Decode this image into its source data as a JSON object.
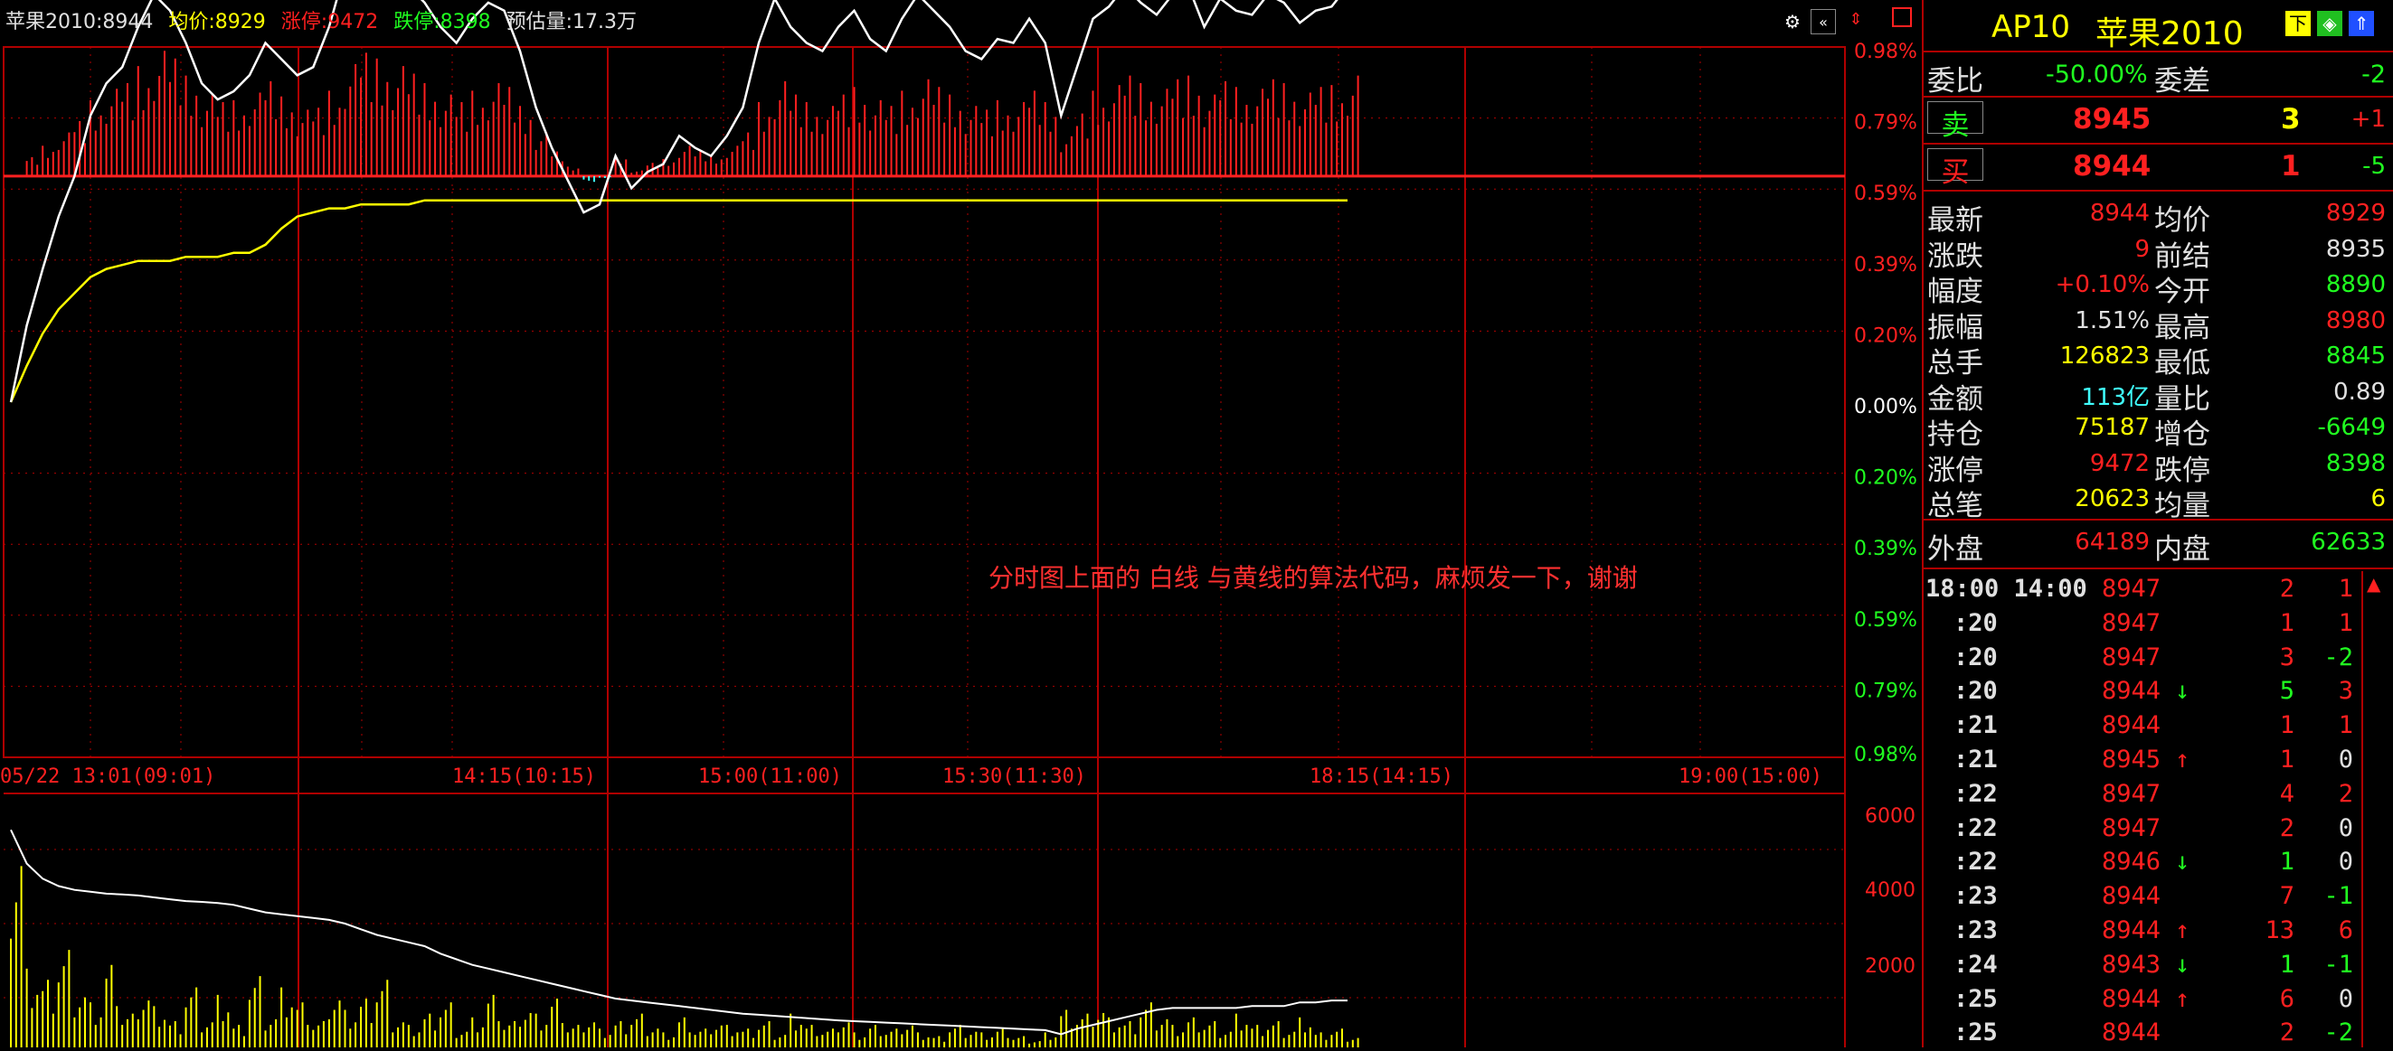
{
  "header": {
    "symbol_price": "苹果2010:8944",
    "avg": "均价:8929",
    "limit_up": "涨停:9472",
    "limit_down": "跌停:8398",
    "est_volume": "预估量:17.3万"
  },
  "annotation": "分时图上面的 白线 与黄线的算法代码，麻烦发一下，谢谢",
  "price_axis_labels": [
    "0.98%",
    "0.79%",
    "0.59%",
    "0.39%",
    "0.20%",
    "0.00%",
    "0.20%",
    "0.39%",
    "0.59%",
    "0.79%",
    "0.98%"
  ],
  "volume_axis_labels": [
    "6000",
    "4000",
    "2000"
  ],
  "time_axis_labels": [
    "05/22 13:01(09:01)",
    "14:15(10:15)",
    "15:00(11:00)",
    "15:30(11:30)",
    "18:15(14:15)",
    "19:00(15:00)"
  ],
  "chart_data": {
    "type": "line",
    "series": [
      {
        "name": "白线",
        "values": [
          8879,
          8898,
          8912,
          8925,
          8935,
          8950,
          8958,
          8962,
          8972,
          8980,
          8976,
          8968,
          8958,
          8954,
          8956,
          8960,
          8968,
          8964,
          8960,
          8962,
          8972,
          8986,
          8993,
          8990,
          8986,
          8982,
          8978,
          8972,
          8968,
          8974,
          8978,
          8976,
          8966,
          8952,
          8942,
          8934,
          8926,
          8928,
          8940,
          8932,
          8936,
          8938,
          8945,
          8942,
          8940,
          8945,
          8952,
          8968,
          8979,
          8972,
          8968,
          8966,
          8972,
          8976,
          8969,
          8966,
          8974,
          8980,
          8976,
          8972,
          8966,
          8964,
          8969,
          8968,
          8974,
          8968,
          8950,
          8962,
          8974,
          8977,
          8982,
          8978,
          8975,
          8980,
          8982,
          8972,
          8979,
          8976,
          8975,
          8980,
          8978,
          8973,
          8976,
          8977,
          8982
        ]
      },
      {
        "name": "黄线",
        "values": [
          8879,
          8888,
          8896,
          8902,
          8906,
          8910,
          8912,
          8913,
          8914,
          8914,
          8914,
          8915,
          8915,
          8915,
          8916,
          8916,
          8918,
          8922,
          8925,
          8926,
          8927,
          8927,
          8928,
          8928,
          8928,
          8928,
          8929,
          8929,
          8929,
          8929,
          8929,
          8929,
          8929,
          8929,
          8929,
          8929,
          8929,
          8929,
          8929,
          8929,
          8929,
          8929,
          8929,
          8929,
          8929,
          8929,
          8929,
          8929,
          8929,
          8929,
          8929,
          8929,
          8929,
          8929,
          8929,
          8929,
          8929,
          8929,
          8929,
          8929,
          8929,
          8929,
          8929,
          8929,
          8929,
          8929,
          8929,
          8929,
          8929,
          8929,
          8929,
          8929,
          8929,
          8929,
          8929,
          8929,
          8929,
          8929,
          8929,
          8929,
          8929,
          8929,
          8929,
          8929,
          8929
        ]
      }
    ],
    "volume": [
      5800,
      2100,
      1800,
      2600,
      1600,
      1200,
      2200,
      900,
      1500,
      1100,
      700,
      1600,
      800,
      1400,
      600,
      1900,
      900,
      1600,
      1200,
      700,
      1500,
      1000,
      1300,
      1800,
      800,
      600,
      900,
      1200,
      500,
      800,
      1400,
      700,
      1100,
      900,
      1300,
      600,
      800,
      500,
      700,
      900,
      600,
      400,
      800,
      500,
      700,
      600,
      500,
      700,
      400,
      900,
      600,
      500,
      800,
      400,
      600,
      500,
      700,
      400,
      300,
      600,
      500,
      400,
      500,
      300,
      200,
      400,
      1000,
      900,
      1100,
      800,
      700,
      1200,
      900,
      600,
      800,
      700,
      500,
      900,
      600,
      700,
      500,
      800,
      400,
      500,
      300
    ],
    "volume_ma": [
      5800,
      4900,
      4500,
      4300,
      4200,
      4150,
      4100,
      4080,
      4050,
      4000,
      3950,
      3900,
      3880,
      3850,
      3800,
      3700,
      3600,
      3550,
      3500,
      3450,
      3400,
      3300,
      3150,
      3000,
      2900,
      2800,
      2700,
      2500,
      2350,
      2200,
      2100,
      2000,
      1900,
      1800,
      1700,
      1600,
      1500,
      1400,
      1300,
      1250,
      1200,
      1150,
      1100,
      1050,
      1000,
      950,
      900,
      870,
      840,
      810,
      780,
      750,
      720,
      700,
      680,
      660,
      640,
      620,
      600,
      580,
      560,
      540,
      520,
      500,
      480,
      460,
      350,
      500,
      600,
      700,
      800,
      900,
      1000,
      1050,
      1050,
      1050,
      1050,
      1050,
      1100,
      1100,
      1100,
      1200,
      1200,
      1250,
      1250
    ],
    "ylim": [
      8791,
      8967
    ],
    "prev_close": 8935
  },
  "panel": {
    "title_code": "AP10",
    "title_name": "苹果2010",
    "rows_top": [
      {
        "l1": "委比",
        "v1": "-50.00%",
        "l2": "委差",
        "v2": "-2"
      }
    ],
    "sell": {
      "label": "卖",
      "price": "8945",
      "qty": "3",
      "chg": "+1"
    },
    "buy": {
      "label": "买",
      "price": "8944",
      "qty": "1",
      "chg": "-5"
    },
    "stats": [
      {
        "l1": "最新",
        "v1": "8944",
        "l2": "均价",
        "v2": "8929"
      },
      {
        "l1": "涨跌",
        "v1": "9",
        "l2": "前结",
        "v2": "8935"
      },
      {
        "l1": "幅度",
        "v1": "+0.10%",
        "l2": "今开",
        "v2": "8890"
      },
      {
        "l1": "振幅",
        "v1": "1.51%",
        "l2": "最高",
        "v2": "8980"
      },
      {
        "l1": "总手",
        "v1": "126823",
        "l2": "最低",
        "v2": "8845"
      },
      {
        "l1": "金额",
        "v1": "113亿",
        "l2": "量比",
        "v2": "0.89"
      },
      {
        "l1": "持仓",
        "v1": "75187",
        "l2": "增仓",
        "v2": "-6649"
      },
      {
        "l1": "涨停",
        "v1": "9472",
        "l2": "跌停",
        "v2": "8398"
      },
      {
        "l1": "总笔",
        "v1": "20623",
        "l2": "均量",
        "v2": "6"
      }
    ],
    "outer": {
      "l1": "外盘",
      "v1": "64189",
      "l2": "内盘",
      "v2": "62633"
    },
    "ticks": [
      {
        "t": "18:00 14:00",
        "p": "8947",
        "a": "",
        "q": "2",
        "d": "1"
      },
      {
        "t": ":20",
        "p": "8947",
        "a": "",
        "q": "1",
        "d": "1"
      },
      {
        "t": ":20",
        "p": "8947",
        "a": "",
        "q": "3",
        "d": "-2"
      },
      {
        "t": ":20",
        "p": "8944",
        "a": "↓",
        "q": "5",
        "d": "3"
      },
      {
        "t": ":21",
        "p": "8944",
        "a": "",
        "q": "1",
        "d": "1"
      },
      {
        "t": ":21",
        "p": "8945",
        "a": "↑",
        "q": "1",
        "d": "0"
      },
      {
        "t": ":22",
        "p": "8947",
        "a": "",
        "q": "4",
        "d": "2"
      },
      {
        "t": ":22",
        "p": "8947",
        "a": "",
        "q": "2",
        "d": "0"
      },
      {
        "t": ":22",
        "p": "8946",
        "a": "↓",
        "q": "1",
        "d": "0"
      },
      {
        "t": ":23",
        "p": "8944",
        "a": "",
        "q": "7",
        "d": "-1"
      },
      {
        "t": ":23",
        "p": "8944",
        "a": "↑",
        "q": "13",
        "d": "6"
      },
      {
        "t": ":24",
        "p": "8943",
        "a": "↓",
        "q": "1",
        "d": "-1"
      },
      {
        "t": ":25",
        "p": "8944",
        "a": "↑",
        "q": "6",
        "d": "0"
      },
      {
        "t": ":25",
        "p": "8944",
        "a": "",
        "q": "2",
        "d": "-2"
      }
    ]
  },
  "colors": {
    "red": "#ff2020",
    "green": "#20ff20",
    "yellow": "#ffff00",
    "white": "#ffffff",
    "cyan": "#40ffff",
    "grid": "#b00000"
  }
}
